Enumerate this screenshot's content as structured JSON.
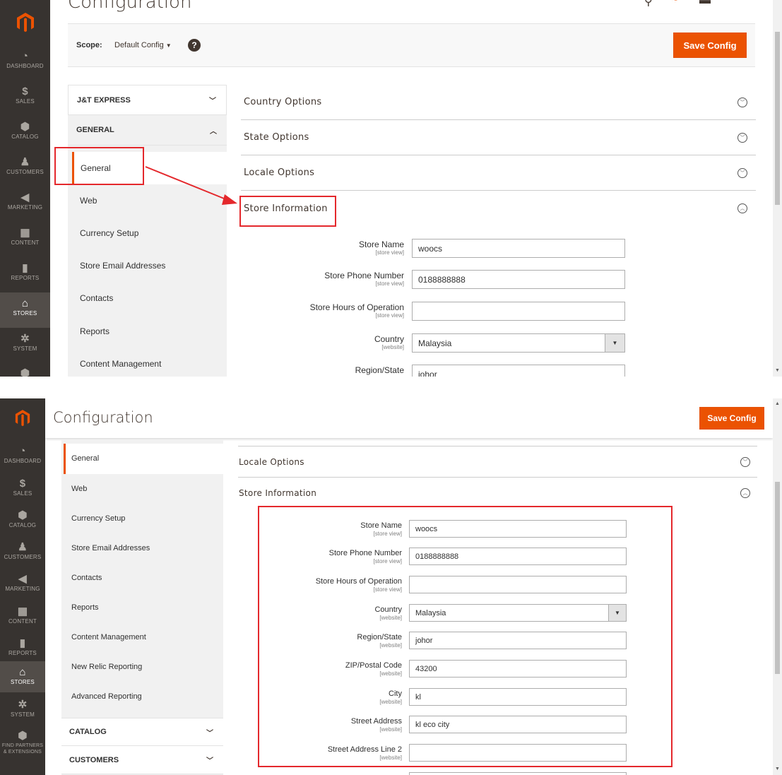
{
  "page": {
    "title": "Configuration",
    "save_label": "Save Config"
  },
  "admin_menu": [
    {
      "label": "DASHBOARD",
      "icon": "gauge-icon",
      "glyph": "◔"
    },
    {
      "label": "SALES",
      "icon": "dollar-icon",
      "glyph": "$"
    },
    {
      "label": "CATALOG",
      "icon": "box-icon",
      "glyph": "⬢"
    },
    {
      "label": "CUSTOMERS",
      "icon": "person-icon",
      "glyph": "♟"
    },
    {
      "label": "MARKETING",
      "icon": "megaphone-icon",
      "glyph": "◀"
    },
    {
      "label": "CONTENT",
      "icon": "layout-icon",
      "glyph": "▦"
    },
    {
      "label": "REPORTS",
      "icon": "bar-chart-icon",
      "glyph": "▮"
    },
    {
      "label": "STORES",
      "icon": "store-icon",
      "glyph": "⌂"
    },
    {
      "label": "SYSTEM",
      "icon": "gear-icon",
      "glyph": "✲"
    },
    {
      "label": "FIND PARTNERS & EXTENSIONS",
      "icon": "cube-icon",
      "glyph": "⬢"
    }
  ],
  "scope": {
    "label": "Scope:",
    "value": "Default Config",
    "help": "?"
  },
  "config_tabs": {
    "jt_express": "J&T EXPRESS",
    "general": "GENERAL",
    "catalog": "CATALOG",
    "customers": "CUSTOMERS"
  },
  "general_items": [
    "General",
    "Web",
    "Currency Setup",
    "Store Email Addresses",
    "Contacts",
    "Reports",
    "Content Management",
    "New Relic Reporting",
    "Advanced Reporting"
  ],
  "sections": {
    "country": "Country Options",
    "state": "State Options",
    "locale": "Locale Options",
    "store_info": "Store Information"
  },
  "store_fields": [
    {
      "label": "Store Name",
      "scope": "[store view]",
      "value": "woocs"
    },
    {
      "label": "Store Phone Number",
      "scope": "[store view]",
      "value": "0188888888"
    },
    {
      "label": "Store Hours of Operation",
      "scope": "[store view]",
      "value": ""
    },
    {
      "label": "Country",
      "scope": "[website]",
      "value": "Malaysia"
    },
    {
      "label": "Region/State",
      "scope": "[website]",
      "value": "johor"
    },
    {
      "label": "ZIP/Postal Code",
      "scope": "[website]",
      "value": "43200"
    },
    {
      "label": "City",
      "scope": "[website]",
      "value": "kl"
    },
    {
      "label": "Street Address",
      "scope": "[website]",
      "value": "kl eco city"
    },
    {
      "label": "Street Address Line 2",
      "scope": "[website]",
      "value": ""
    }
  ],
  "colors": {
    "accent": "#eb5202",
    "sidebar": "#373330",
    "annotation": "#e4282c"
  }
}
